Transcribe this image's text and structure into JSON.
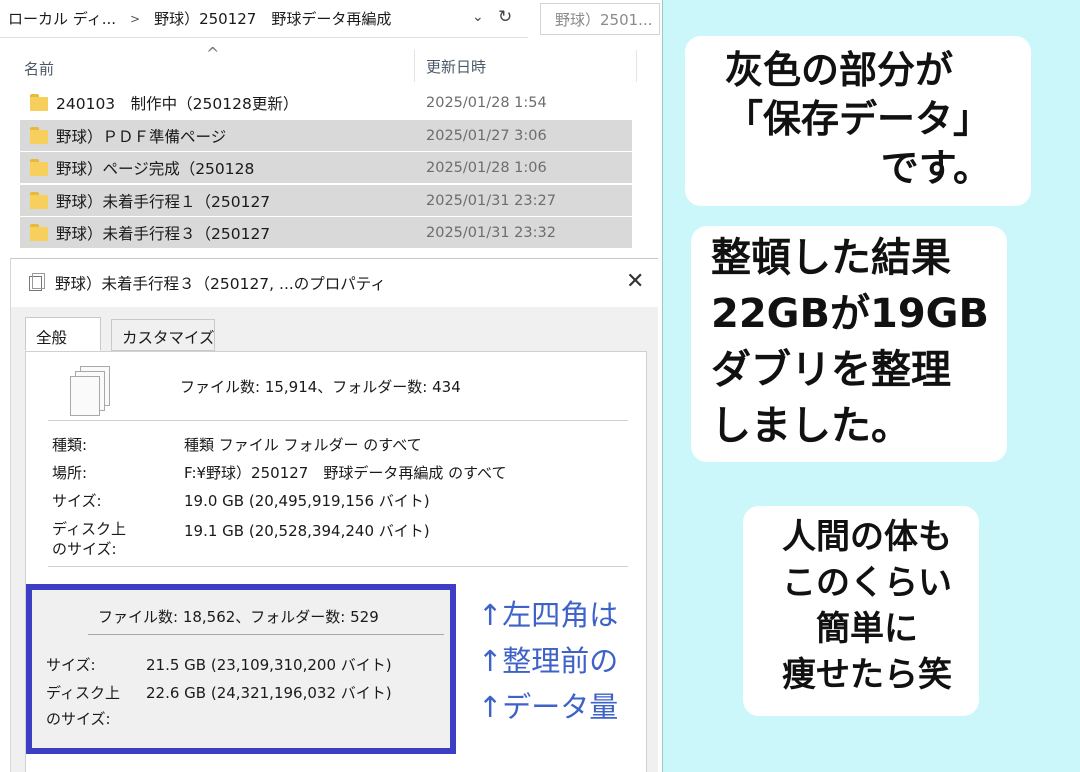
{
  "explorer": {
    "breadcrumb": [
      "ローカル ディ...",
      "野球）250127　野球データ再編成"
    ],
    "search_placeholder": "野球）2501...",
    "columns": {
      "name": "名前",
      "date": "更新日時"
    },
    "rows": [
      {
        "name": "240103　制作中（250128更新）",
        "date": "2025/01/28 1:54",
        "selected": false
      },
      {
        "name": "野球）ＰＤＦ準備ページ",
        "date": "2025/01/27 3:06",
        "selected": true
      },
      {
        "name": "野球）ページ完成（250128",
        "date": "2025/01/28 1:06",
        "selected": true
      },
      {
        "name": "野球）未着手行程１（250127",
        "date": "2025/01/31 23:27",
        "selected": true
      },
      {
        "name": "野球）未着手行程３（250127",
        "date": "2025/01/31 23:32",
        "selected": true
      }
    ]
  },
  "properties": {
    "title": "野球）未着手行程３（250127, ...のプロパティ",
    "tabs": [
      "全般",
      "カスタマイズ"
    ],
    "counts": "ファイル数: 15,914、フォルダー数: 434",
    "fields": [
      {
        "label": "種類:",
        "value": "種類 ファイル フォルダー のすべて"
      },
      {
        "label": "場所:",
        "value": "F:¥野球）250127　野球データ再編成 のすべて"
      },
      {
        "label": "サイズ:",
        "value": "19.0 GB (20,495,919,156 バイト)"
      },
      {
        "label": "ディスク上",
        "label2": "のサイズ:",
        "value": "19.1 GB (20,528,394,240 バイト)"
      }
    ]
  },
  "original_box": {
    "counts": "ファイル数: 18,562、フォルダー数: 529",
    "size_label": "サイズ:",
    "size_value": "21.5 GB (23,109,310,200 バイト)",
    "disk_label": "ディスク上",
    "disk_label2": "のサイズ:",
    "disk_value": "22.6 GB (24,321,196,032 バイト)"
  },
  "note": [
    "↑左四角は",
    "↑整理前の",
    "↑データ量"
  ],
  "aside": {
    "bubble1": [
      "灰色の部分が",
      "「保存データ」",
      "です。"
    ],
    "bubble2": [
      "整頓した結果",
      "22GBが19GB",
      "ダブリを整理",
      "しました。"
    ],
    "bubble3": [
      "人間の体も",
      "このくらい",
      "簡単に",
      "痩せたら笑"
    ]
  },
  "colors": {
    "selection": "#d9d9d9",
    "box_border": "#3c3fc4",
    "note_text": "#3e62c8",
    "aside_bg": "#ccf7fa",
    "folder": "#f6cf5c"
  }
}
